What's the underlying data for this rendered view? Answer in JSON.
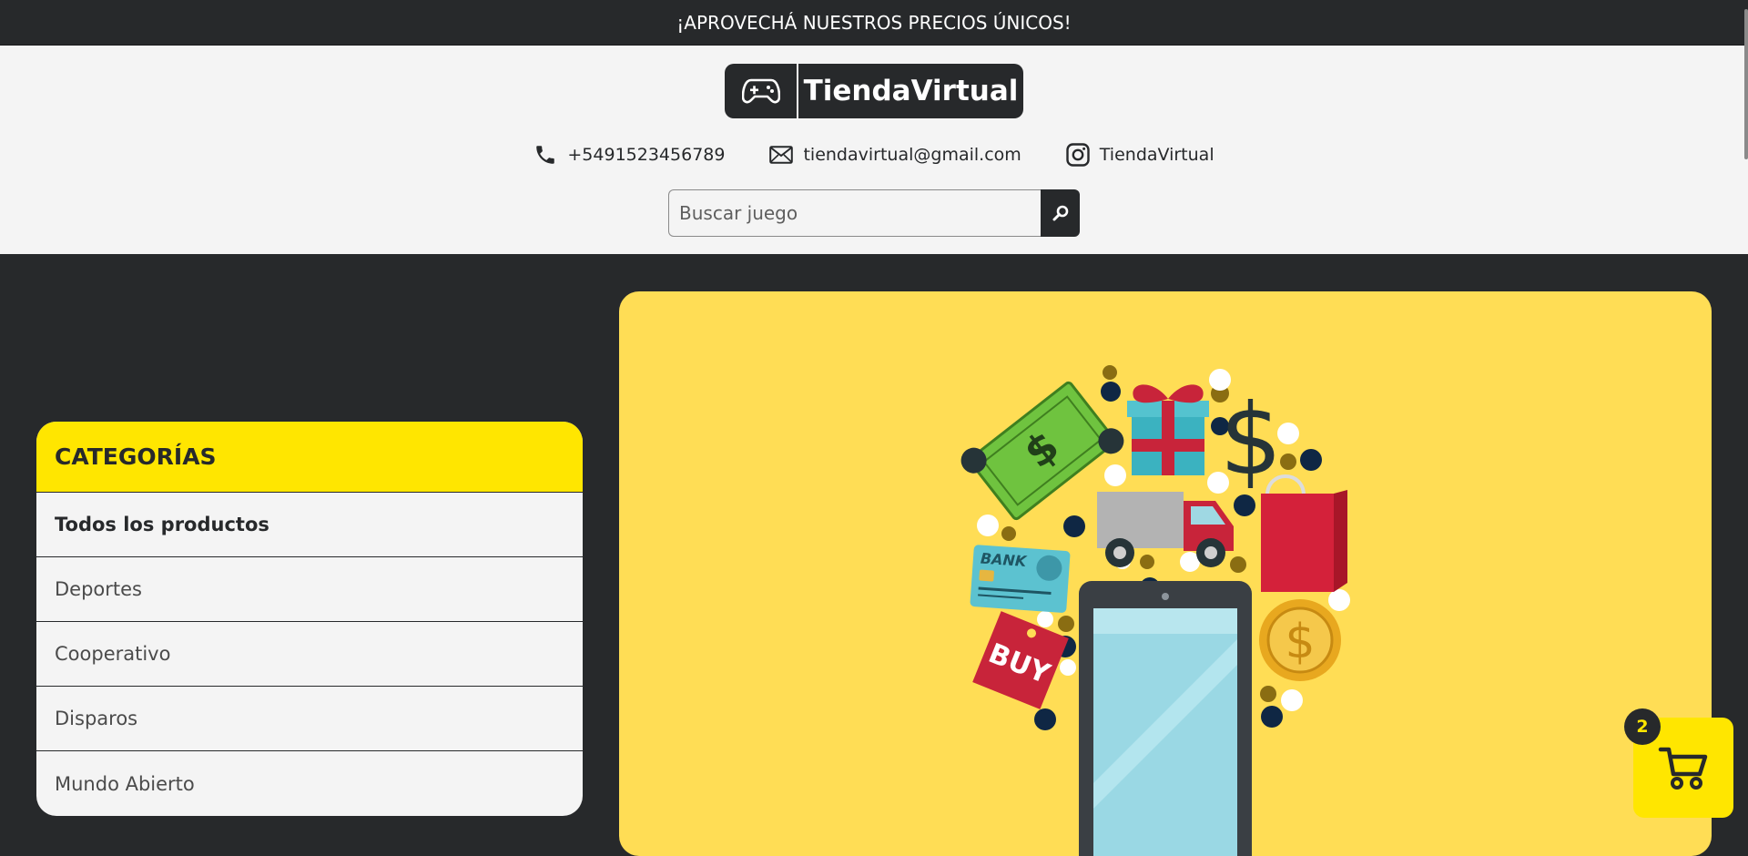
{
  "promo": {
    "text": "¡APROVECHÁ NUESTROS PRECIOS ÚNICOS!"
  },
  "logo": {
    "name": "TiendaVirtual",
    "icon": "gamepad-icon"
  },
  "contacts": {
    "phone": {
      "icon": "phone-icon",
      "text": "+5491523456789"
    },
    "email": {
      "icon": "mail-icon",
      "text": "tiendavirtual@gmail.com"
    },
    "instagram": {
      "icon": "instagram-icon",
      "text": "TiendaVirtual"
    }
  },
  "search": {
    "placeholder": "Buscar juego",
    "value": "",
    "icon": "search-icon"
  },
  "categories": {
    "title": "CATEGORÍAS",
    "items": [
      {
        "label": "Todos los productos",
        "active": true
      },
      {
        "label": "Deportes",
        "active": false
      },
      {
        "label": "Cooperativo",
        "active": false
      },
      {
        "label": "Disparos",
        "active": false
      },
      {
        "label": "Mundo Abierto",
        "active": false
      }
    ]
  },
  "hero": {
    "icon": "shopping-illustration",
    "credit_card_label": "BANK",
    "tag_label": "BUY",
    "dollar_sign": "$"
  },
  "cart": {
    "icon": "cart-icon",
    "count": "2"
  },
  "colors": {
    "dark": "#27292b",
    "light": "#f4f4f4",
    "accent": "#ffe600",
    "hero_bg": "#ffdd55"
  }
}
